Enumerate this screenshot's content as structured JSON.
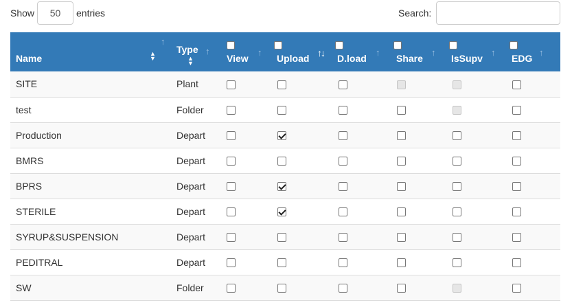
{
  "length_menu": {
    "show_label": "Show",
    "value": "50",
    "entries_label": "entries"
  },
  "search": {
    "label": "Search:",
    "value": "",
    "placeholder": ""
  },
  "columns": [
    {
      "label": "Name"
    },
    {
      "label": "Type"
    },
    {
      "label": "View"
    },
    {
      "label": "Upload"
    },
    {
      "label": "D.load"
    },
    {
      "label": "Share"
    },
    {
      "label": "IsSupv"
    },
    {
      "label": "EDG"
    }
  ],
  "header_colors": {
    "background": "#337ab7",
    "text": "#ffffff"
  },
  "rows": [
    {
      "name": "SITE",
      "type": "Plant",
      "view": false,
      "upload": false,
      "dload": false,
      "share": "disabled",
      "issupv": "disabled",
      "edg": false
    },
    {
      "name": "test",
      "type": "Folder",
      "view": false,
      "upload": false,
      "dload": false,
      "share": false,
      "issupv": "disabled",
      "edg": false
    },
    {
      "name": "Production",
      "type": "Depart",
      "view": false,
      "upload": true,
      "dload": false,
      "share": false,
      "issupv": false,
      "edg": false
    },
    {
      "name": "BMRS",
      "type": "Depart",
      "view": false,
      "upload": false,
      "dload": false,
      "share": false,
      "issupv": false,
      "edg": false
    },
    {
      "name": "BPRS",
      "type": "Depart",
      "view": false,
      "upload": true,
      "dload": false,
      "share": false,
      "issupv": false,
      "edg": false
    },
    {
      "name": "STERILE",
      "type": "Depart",
      "view": false,
      "upload": true,
      "dload": false,
      "share": false,
      "issupv": false,
      "edg": false
    },
    {
      "name": "SYRUP&SUSPENSION",
      "type": "Depart",
      "view": false,
      "upload": false,
      "dload": false,
      "share": false,
      "issupv": false,
      "edg": false
    },
    {
      "name": "PEDITRAL",
      "type": "Depart",
      "view": false,
      "upload": false,
      "dload": false,
      "share": false,
      "issupv": false,
      "edg": false
    },
    {
      "name": "SW",
      "type": "Folder",
      "view": false,
      "upload": false,
      "dload": false,
      "share": false,
      "issupv": "disabled",
      "edg": false
    }
  ]
}
